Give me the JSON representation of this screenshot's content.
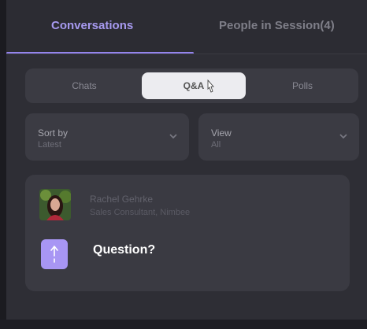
{
  "tabs": [
    {
      "label": "Conversations",
      "active": true
    },
    {
      "label": "People in Session(4)",
      "active": false
    }
  ],
  "segments": [
    {
      "label": "Chats"
    },
    {
      "label": "Q&A",
      "selected": true
    },
    {
      "label": "Polls"
    }
  ],
  "filters": {
    "sort": {
      "label": "Sort by",
      "value": "Latest"
    },
    "view": {
      "label": "View",
      "value": "All"
    }
  },
  "question_card": {
    "user_name": "Rachel Gehrke",
    "user_role": "Sales Consultant, Nimbee",
    "question": "Question?",
    "vote_icon": "upvote-arrow-icon",
    "avatar_icon": "user-avatar"
  },
  "colors": {
    "accent": "#9484ec",
    "vote_button": "#a896f4",
    "panel_bg": "#2e2e35",
    "card_bg": "#3a3a42"
  }
}
